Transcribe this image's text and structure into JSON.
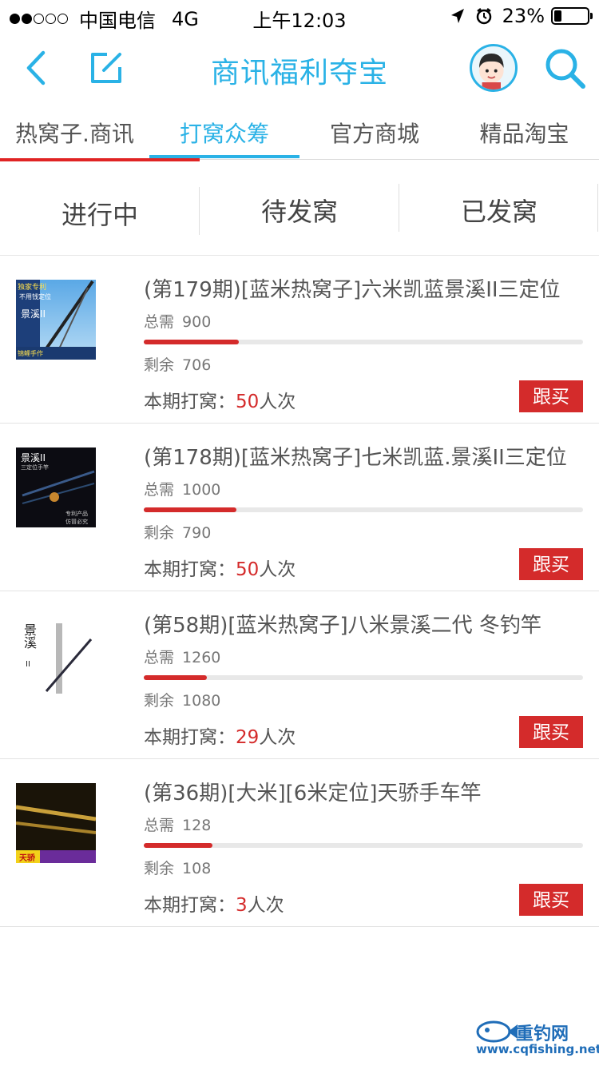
{
  "status_bar": {
    "carrier": "中国电信",
    "network": "4G",
    "time": "上午12:03",
    "battery": "23%",
    "battery_level": 0.23,
    "signal_bars_filled": 2,
    "signal_bars_total": 5
  },
  "nav": {
    "title": "商讯福利夺宝",
    "icons": [
      "back-icon",
      "edit-icon",
      "avatar",
      "search-icon"
    ],
    "accent_color": "#2ab2e6"
  },
  "top_tabs": [
    {
      "label": "热窝子.商讯"
    },
    {
      "label": "打窝众筹"
    },
    {
      "label": "官方商城"
    },
    {
      "label": "精品淘宝"
    }
  ],
  "active_top_tab": "打窝众筹",
  "sub_tabs": [
    {
      "label": "进行中"
    },
    {
      "label": "待发窝"
    },
    {
      "label": "已发窝"
    }
  ],
  "items": [
    {
      "title": "(第179期)[蓝米热窝子]六米凯蓝景溪II三定位",
      "total_label": "总需",
      "total": "900",
      "remain_label": "剩余",
      "remain": "706",
      "progress": 0.216,
      "period_label": "本期打窝：",
      "period_count": "50",
      "period_unit": "人次",
      "buy_label": "跟买",
      "thumb_text": [
        "独家专利",
        "不用钱定位",
        "景溪II",
        "锦鲤手作"
      ]
    },
    {
      "title": "(第178期)[蓝米热窝子]七米凯蓝.景溪II三定位",
      "total_label": "总需",
      "total": "1000",
      "remain_label": "剩余",
      "remain": "790",
      "progress": 0.21,
      "period_label": "本期打窝：",
      "period_count": "50",
      "period_unit": "人次",
      "buy_label": "跟买",
      "thumb_text": [
        "景溪II",
        "三定位手竿",
        "专利产品",
        "仿冒必究"
      ]
    },
    {
      "title": "(第58期)[蓝米热窝子]八米景溪二代 冬钓竿",
      "total_label": "总需",
      "total": "1260",
      "remain_label": "剩余",
      "remain": "1080",
      "progress": 0.143,
      "period_label": "本期打窝：",
      "period_count": "29",
      "period_unit": "人次",
      "buy_label": "跟买",
      "thumb_text": [
        "景溪",
        "II"
      ]
    },
    {
      "title": "(第36期)[大米][6米定位]天骄手车竿",
      "total_label": "总需",
      "total": "128",
      "remain_label": "剩余",
      "remain": "108",
      "progress": 0.156,
      "period_label": "本期打窝：",
      "period_count": "3",
      "period_unit": "人次",
      "buy_label": "跟买",
      "thumb_text": [
        "天骄"
      ]
    }
  ],
  "watermark": {
    "title": "重钓网",
    "url": "www.cqfishing.net"
  },
  "colors": {
    "accent_blue": "#2ab2e6",
    "buy_red": "#d42b2b"
  }
}
